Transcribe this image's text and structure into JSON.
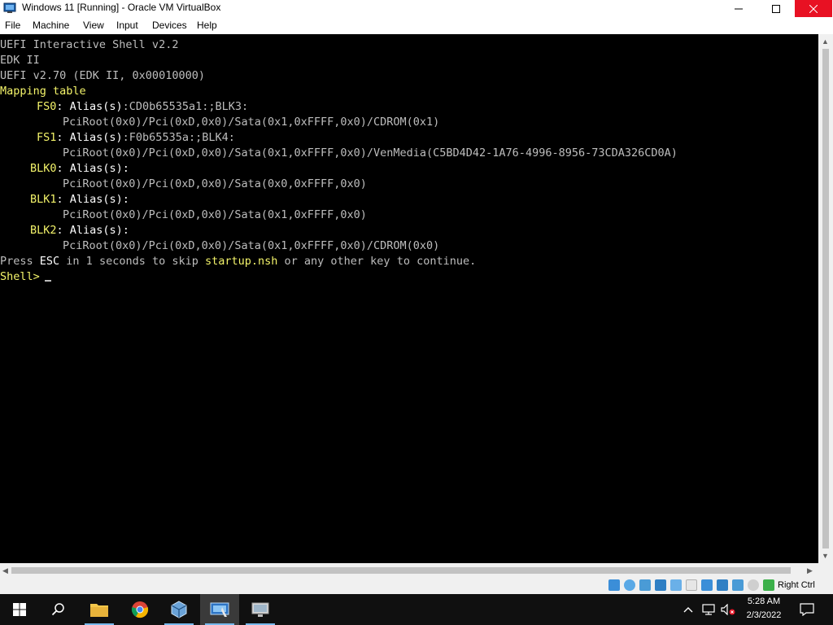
{
  "window": {
    "title": "Windows 11 [Running] - Oracle VM VirtualBox"
  },
  "menu": {
    "items": [
      "File",
      "Machine",
      "View",
      "Input",
      "Devices",
      "Help"
    ]
  },
  "console": {
    "lines": {
      "l1": "UEFI Interactive Shell v2.2",
      "l2": "EDK II",
      "l3": "UEFI v2.70 (EDK II, 0x00010000)",
      "l4": "Mapping table",
      "fs0_name": "FS0",
      "fs0_alias_label": ": Alias(s)",
      "fs0_alias_value": ":CD0b65535a1:;BLK3:",
      "fs0_path": "PciRoot(0x0)/Pci(0xD,0x0)/Sata(0x1,0xFFFF,0x0)/CDROM(0x1)",
      "fs1_name": "FS1",
      "fs1_alias_label": ": Alias(s)",
      "fs1_alias_value": ":F0b65535a:;BLK4:",
      "fs1_path": "PciRoot(0x0)/Pci(0xD,0x0)/Sata(0x1,0xFFFF,0x0)/VenMedia(C5BD4D42-1A76-4996-8956-73CDA326CD0A)",
      "blk0_name": "BLK0",
      "blk0_alias_label": ": Alias(s):",
      "blk0_path": "PciRoot(0x0)/Pci(0xD,0x0)/Sata(0x0,0xFFFF,0x0)",
      "blk1_name": "BLK1",
      "blk1_alias_label": ": Alias(s):",
      "blk1_path": "PciRoot(0x0)/Pci(0xD,0x0)/Sata(0x1,0xFFFF,0x0)",
      "blk2_name": "BLK2",
      "blk2_alias_label": ": Alias(s):",
      "blk2_path": "PciRoot(0x0)/Pci(0xD,0x0)/Sata(0x1,0xFFFF,0x0)/CDROM(0x0)",
      "press_1": "Press ",
      "press_esc": "ESC",
      "press_2": " in 1 seconds to skip ",
      "press_nsh": "startup.nsh",
      "press_3": " or any other key to continue.",
      "prompt": "Shell> "
    }
  },
  "statusbar": {
    "host_key": "Right Ctrl"
  },
  "taskbar": {
    "time": "5:28 AM",
    "date": "2/3/2022"
  },
  "colors": {
    "console_bg": "#000000",
    "console_yellow": "#f4f46a",
    "console_gray": "#bdbdbd",
    "close_red": "#e81123",
    "taskbar_bg": "#101010"
  }
}
